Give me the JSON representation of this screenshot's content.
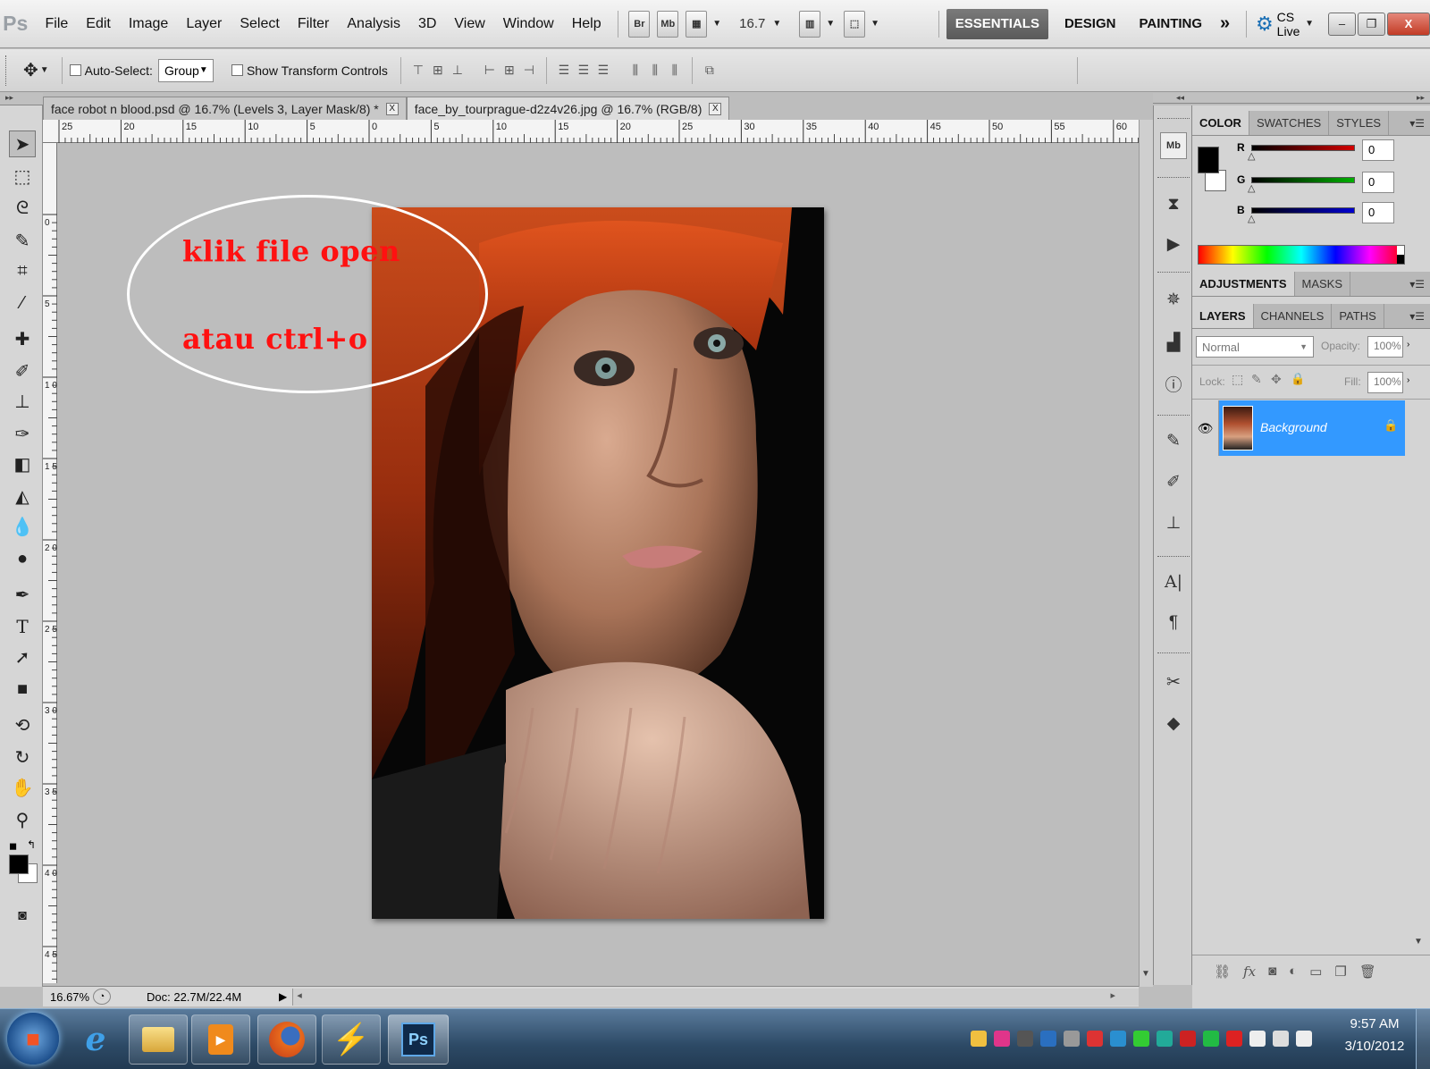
{
  "app": {
    "logo": "Ps"
  },
  "menu": [
    "File",
    "Edit",
    "Image",
    "Layer",
    "Select",
    "Filter",
    "Analysis",
    "3D",
    "View",
    "Window",
    "Help"
  ],
  "menubar_tools": {
    "bridge": "Br",
    "mini_bridge": "Mb",
    "zoom_value": "16.7"
  },
  "workspaces": [
    "ESSENTIALS",
    "DESIGN",
    "PAINTING"
  ],
  "workspace_more": "»",
  "cs_live": "CS Live",
  "window_controls": {
    "minimize": "–",
    "restore": "❐",
    "close": "X"
  },
  "options_bar": {
    "auto_select_label": "Auto-Select:",
    "auto_select_value": "Group",
    "transform_label": "Show Transform Controls"
  },
  "doc_tabs": [
    {
      "title": "face robot n blood.psd @ 16.7% (Levels 3, Layer Mask/8) *",
      "close": "X"
    },
    {
      "title": "face_by_tourprague-d2z4v26.jpg @ 16.7% (RGB/8)",
      "close": "X"
    }
  ],
  "ruler_h_labels": [
    "25",
    "20",
    "15",
    "10",
    "5",
    "0",
    "5",
    "10",
    "15",
    "20",
    "25",
    "30",
    "35",
    "40",
    "45",
    "50",
    "55",
    "60"
  ],
  "ruler_v_labels": [
    "0",
    "5",
    "1 0",
    "1 5",
    "2 0",
    "2 5",
    "3 0",
    "3 5",
    "4 0",
    "4 5"
  ],
  "annotation": {
    "line1": "klik file open",
    "line2": "atau ctrl+o",
    "color": "#ff1111"
  },
  "status": {
    "zoom": "16.67%",
    "doc": "Doc: 22.7M/22.4M"
  },
  "color_panel": {
    "tabs": [
      "COLOR",
      "SWATCHES",
      "STYLES"
    ],
    "channels": [
      {
        "label": "R",
        "value": "0",
        "color": "#d40000"
      },
      {
        "label": "G",
        "value": "0",
        "color": "#00b000"
      },
      {
        "label": "B",
        "value": "0",
        "color": "#0000d0"
      }
    ]
  },
  "adjustments_tabs": [
    "ADJUSTMENTS",
    "MASKS"
  ],
  "layers_panel": {
    "tabs": [
      "LAYERS",
      "CHANNELS",
      "PATHS"
    ],
    "blend_mode": "Normal",
    "opacity_label": "Opacity:",
    "opacity_value": "100%",
    "lock_label": "Lock:",
    "fill_label": "Fill:",
    "fill_value": "100%",
    "layers": [
      {
        "name": "Background",
        "selected": true,
        "locked": true
      }
    ],
    "bottom_icons": [
      "link-icon",
      "fx-icon",
      "mask-icon",
      "adjustment-icon",
      "group-icon",
      "new-layer-icon",
      "trash-icon"
    ]
  },
  "taskbar": {
    "apps": [
      "internet-explorer-icon",
      "explorer-icon",
      "media-player-icon",
      "firefox-icon",
      "winamp-icon",
      "photoshop-icon"
    ],
    "ps_label": "Ps",
    "time": "9:57 AM",
    "date": "3/10/2012"
  }
}
